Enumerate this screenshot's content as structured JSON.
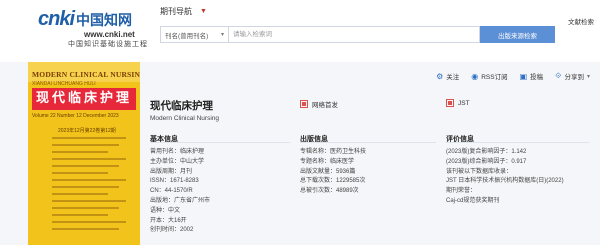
{
  "header": {
    "logo_mark": "cnki",
    "logo_mark_cn": "中国知网",
    "logo_url": "www.cnki.net",
    "logo_subtitle": "中国知识基础设施工程",
    "journal_nav_label": "期刊导航",
    "search": {
      "select_value": "刊名(曾用刊名)",
      "placeholder": "请输入检索词",
      "button_label": "出版来源检索"
    },
    "right_text": "文献检索"
  },
  "cover": {
    "en_title": "MODERN CLINICAL NURSING",
    "pinyin": "XIANDAI  LINCHUANG  HULI",
    "cn_title": "现代临床护理",
    "issue_line": "Volume 22  Number 12  December 2023",
    "issue_line2": "2023年12月第22卷第12期"
  },
  "toolbar": {
    "follow": "关注",
    "rss": "RSS订阅",
    "submit": "投稿",
    "share": "分享到"
  },
  "journal": {
    "title": "现代临床护理",
    "title_en": "Modern Clinical Nursing",
    "badge_network_first": "网络首发",
    "badge_jst": "JST"
  },
  "sections": {
    "basic": {
      "heading": "基本信息",
      "rows": [
        "曾用刊名：临床护理",
        "主办单位：中山大学",
        "出版周期：月刊",
        "ISSN：1671-8283",
        "CN：44-1570/R",
        "出版地：广东省广州市",
        "语种：中文",
        "开本：大16开",
        "创刊时间：2002"
      ]
    },
    "publish": {
      "heading": "出版信息",
      "rows": [
        "专辑名称：医药卫生科技",
        "专题名称：临床医学",
        "出版文献量：5936篇",
        "总下载次数：1229585次",
        "总被引次数：48989次"
      ]
    },
    "eval": {
      "heading": "评价信息",
      "rows": [
        "(2023版)复合影响因子：1.142",
        "(2023版)综合影响因子：0.917",
        "该刊被以下数据库收录：",
        "JST 日本科学技术振兴机构数据库(日)(2022)",
        "期刊荣誉：",
        "Caj-cd规范获奖期刊"
      ]
    }
  },
  "colors": {
    "accent": "#5b8fd6",
    "cover_yellow": "#f2c31a",
    "cover_red": "#e7283a",
    "logo_blue": "#1f5ea8"
  }
}
